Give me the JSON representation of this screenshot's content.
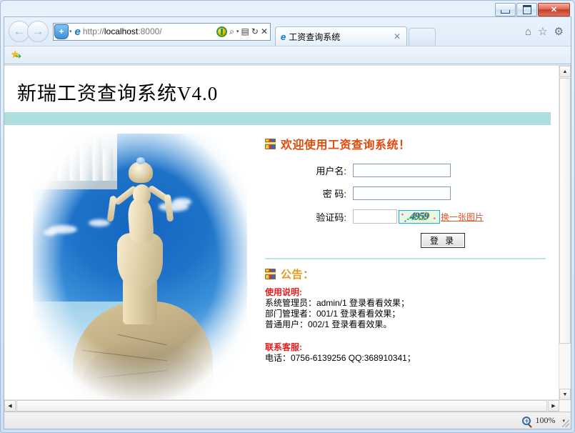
{
  "browser": {
    "window_controls": {
      "minimize": "–",
      "maximize": "□",
      "close": "✕"
    },
    "back_icon": "←",
    "forward_icon": "→",
    "address_value": "http://localhost:8000/",
    "address_scheme": "http://",
    "address_host": "localhost",
    "address_port": ":8000/",
    "shield_label": "+",
    "tab_title": "工资查询系统",
    "tab_close": "✕",
    "icons": {
      "search": "search-icon",
      "compat": "compatibility-view-icon",
      "refresh": "refresh-icon",
      "stop": "stop-icon",
      "home": "home-icon",
      "favorites": "favorites-star-icon",
      "tools": "tools-gear-icon"
    },
    "home_glyph": "⌂",
    "star_glyph": "☆",
    "gear_glyph": "⚙",
    "refresh_glyph": "↻",
    "stop_glyph": "✕",
    "search_glyph": "⌕",
    "compat_glyph": "▤",
    "caret_glyph": "▾",
    "favorites_bar": {
      "star_glyph": "★",
      "arrow_glyph": "➜"
    }
  },
  "page": {
    "site_title": "新瑞工资查询系统V4.0",
    "welcome": "欢迎使用工资查询系统！",
    "form": {
      "username_label": "用户名:",
      "username_value": "",
      "password_label": "密  码:",
      "password_value": "",
      "captcha_label": "验证码:",
      "captcha_value": "",
      "captcha_image_text": "4959",
      "refresh_captcha_link": "换一张图片",
      "login_button": "登 录"
    },
    "notice": {
      "title": "公告：",
      "usage_heading": "使用说明:",
      "usage_lines": [
        "系统管理员：admin/1 登录看看效果；",
        "部门管理者：001/1 登录看看效果；",
        "普通用户：002/1 登录看看效果。"
      ],
      "contact_heading": "联系客服:",
      "contact_line": "电话：0756-6139256 QQ:368910341；"
    },
    "photo_alt": "珠海渔女雕像"
  },
  "status": {
    "zoom_level": "100%",
    "zoom_caret": "▾"
  },
  "colors": {
    "teal_bar": "#aeddde",
    "divider": "#b9e6e6",
    "welcome_orange": "#e24a0a",
    "notice_gold": "#e29b19",
    "red_heading": "#e81c1c",
    "link_orange": "#e0562b",
    "captcha_blue": "#3060e0"
  }
}
